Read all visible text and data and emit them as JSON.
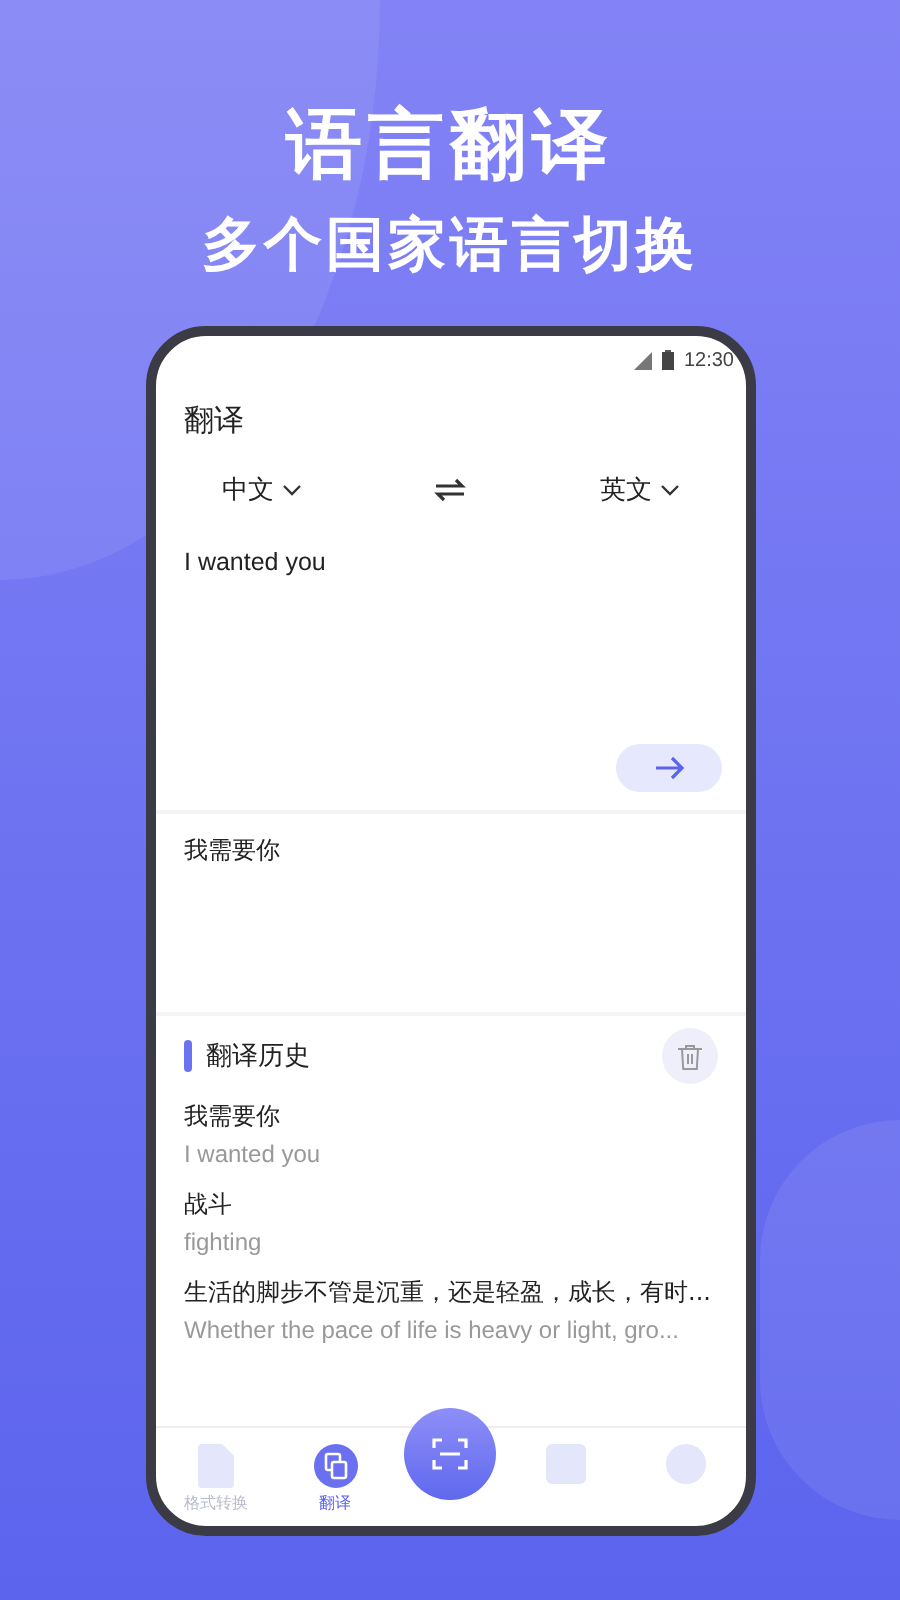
{
  "promo": {
    "title": "语言翻译",
    "subtitle": "多个国家语言切换"
  },
  "status_bar": {
    "time": "12:30"
  },
  "page_title": "翻译",
  "languages": {
    "source": "中文",
    "target": "英文"
  },
  "input": {
    "value": "I wanted you"
  },
  "result": "我需要你",
  "history": {
    "title": "翻译历史",
    "items": [
      {
        "source": "我需要你",
        "translation": "I wanted you"
      },
      {
        "source": "战斗",
        "translation": "fighting"
      },
      {
        "source": "生活的脚步不管是沉重，还是轻盈，成长，有时...",
        "translation": "Whether the pace of life is heavy or light, gro..."
      }
    ]
  },
  "nav": [
    {
      "kind": "document",
      "label": "格式转换",
      "selected": false
    },
    {
      "kind": "translate",
      "label": "翻译",
      "selected": true
    },
    {
      "kind": "scan"
    },
    {
      "kind": "square",
      "selected": false
    },
    {
      "kind": "circle",
      "selected": false
    }
  ]
}
